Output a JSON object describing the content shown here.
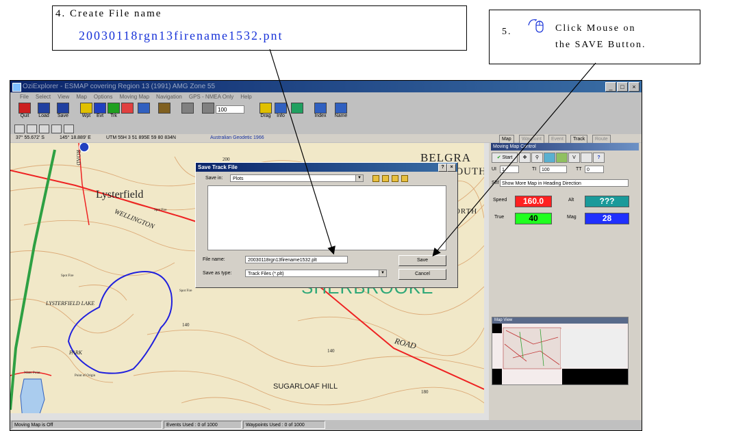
{
  "callout_step4": {
    "line1": "4.  Create File name",
    "line2": "20030118rgn13firename1532.pnt"
  },
  "callout_step5": {
    "number": "5.",
    "line1": "Click Mouse on",
    "line2": "the SAVE Button."
  },
  "app": {
    "title": "OziExplorer - ESMAP covering Region 13 (1991) AMG Zone 55",
    "window_buttons": [
      "_",
      "□",
      "×"
    ],
    "menu": [
      "File",
      "Select",
      "View",
      "Map",
      "Options",
      "Moving Map",
      "Navigation",
      "GPS - NMEA Only",
      "Help"
    ],
    "toolbar": [
      {
        "label": "Quit",
        "color": "#cc2020"
      },
      {
        "label": "Load",
        "color": "#2040a0"
      },
      {
        "label": "Save",
        "color": "#2040a0"
      },
      {
        "label": "Wpt",
        "color": "#e0c000"
      },
      {
        "label": "Evt",
        "color": "#2040c0"
      },
      {
        "label": "Trk",
        "color": "#20a020"
      },
      {
        "label": "",
        "color": "#e04040"
      },
      {
        "label": "",
        "color": "#3060c0"
      },
      {
        "label": "",
        "color": "#806020"
      },
      {
        "label": "",
        "color": "#808080"
      },
      {
        "label": "",
        "color": "#808080"
      },
      {
        "label": "Drag",
        "color": "#e0c000"
      },
      {
        "label": "Info",
        "color": "#3060c0"
      },
      {
        "label": "",
        "color": "#20a060"
      },
      {
        "label": "Index",
        "color": "#3060c0"
      },
      {
        "label": "Name",
        "color": "#3060c0"
      }
    ],
    "zoom_value": "100",
    "coords": {
      "lat": "37° 55.672' S",
      "lon": "145° 18.889' E",
      "utm": "UTM  55H   3 51 895E   59 80 834N",
      "datum": "Australian Geodetic 1966"
    },
    "tabs": [
      "Map",
      "Waypoint",
      "Event",
      "Track",
      "Route"
    ]
  },
  "map": {
    "labels": {
      "belgrave": "BELGRA",
      "south": "SOUTH",
      "lysterfield": "Lysterfield",
      "road": "ROAD",
      "wellington": "WELLINGTON",
      "spot_fire1": "Spot Fire",
      "spot_fire2": "Spot Fire",
      "spot_fire3": "Spot Fire",
      "lysterfield_lake": "LYSTERFIELD LAKE",
      "sherbrooke": "SHERBROOKE",
      "road2": "ROAD",
      "park": "PARK",
      "point_of_origin": "Point of Origin",
      "water_point": "Water Point",
      "sugarloaf": "SUGARLOAF HILL",
      "h200": "200",
      "h140a": "140",
      "h140b": "140",
      "h180": "180",
      "north": "NORTH"
    }
  },
  "dialog": {
    "title": "Save Track File",
    "title_buttons": [
      "?",
      "×"
    ],
    "save_in_label": "Save in:",
    "save_in_value": "Plots",
    "file_name_label": "File name:",
    "file_name_value": "20030118rgn13firename1532.plt",
    "save_type_label": "Save as type:",
    "save_type_value": "Track Files (*.plt)",
    "save_button": "Save",
    "cancel_button": "Cancel"
  },
  "panel": {
    "title": "Moving Map Control",
    "start": "Start",
    "ui_label": "UI",
    "ui_value": "1",
    "ti_label": "TI",
    "ti_value": "100",
    "tt_label": "TT",
    "tt_value": "0",
    "v_label": "V",
    "shift_label": "Shf",
    "shift_value": "Show More Map in Heading Direction",
    "speed_label": "Speed",
    "speed_value": "160.0",
    "alt_label": "Alt",
    "alt_value": "???",
    "true_label": "True",
    "true_value": "40",
    "mag_label": "Mag",
    "mag_value": "28",
    "colors": {
      "speed": "#ff2020",
      "alt": "#1a9a9a",
      "true": "#20ff20",
      "mag": "#2030ff"
    },
    "map_view_title": "Map View"
  },
  "status": {
    "left": "Moving Map is Off",
    "events": "Events Used : 0 of 1000",
    "waypoints": "Waypoints Used : 0 of 1000"
  }
}
